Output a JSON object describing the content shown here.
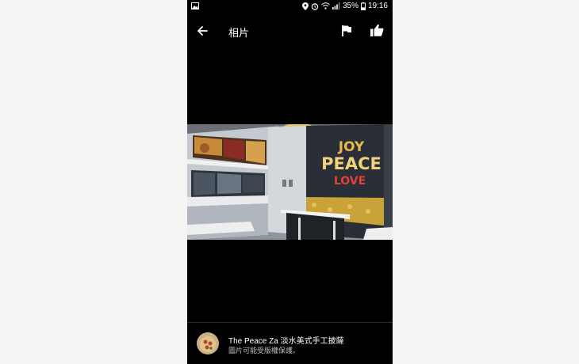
{
  "status_bar": {
    "battery": "35%",
    "time": "19:16",
    "left_icons": [
      "gallery-icon"
    ],
    "right_icons": [
      "location-icon",
      "alarm-icon",
      "wifi-icon",
      "signal-icon",
      "battery-icon"
    ]
  },
  "toolbar": {
    "title": "相片",
    "back_icon": "back-arrow-icon",
    "flag_icon": "flag-icon",
    "like_icon": "thumbs-up-icon"
  },
  "photo": {
    "wall_text": [
      "JOY",
      "PEACE",
      "LOVE"
    ],
    "wall_text_colors": [
      "#e8b84a",
      "#f0d27a",
      "#e0403a"
    ]
  },
  "footer": {
    "place_name": "The Peace Za 淡水美式手工披薩",
    "copyright_note": "圖片可能受版權保護。"
  }
}
